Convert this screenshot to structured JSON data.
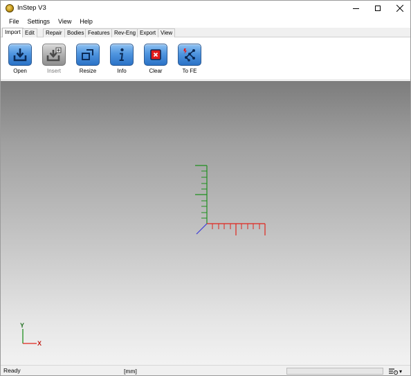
{
  "window": {
    "title": "InStep V3"
  },
  "menu": {
    "items": [
      "File",
      "Settings",
      "View",
      "Help"
    ]
  },
  "tabs": [
    {
      "label": "Import",
      "active": true
    },
    {
      "label": "Edit",
      "active": false
    },
    {
      "label": "Repair",
      "active": false
    },
    {
      "label": "Bodies",
      "active": false
    },
    {
      "label": "Features",
      "active": false
    },
    {
      "label": "Rev-Eng",
      "active": false
    },
    {
      "label": "Export",
      "active": false
    },
    {
      "label": "View",
      "active": false
    }
  ],
  "toolbar": {
    "tools": [
      {
        "label": "Open",
        "icon": "open-import-icon",
        "enabled": true
      },
      {
        "label": "Insert",
        "icon": "insert-icon",
        "enabled": false
      },
      {
        "label": "Resize",
        "icon": "resize-icon",
        "enabled": true
      },
      {
        "label": "Info",
        "icon": "info-icon",
        "enabled": true
      },
      {
        "label": "Clear",
        "icon": "clear-icon",
        "enabled": true
      },
      {
        "label": "To FE",
        "icon": "to-fe-icon",
        "enabled": true
      }
    ]
  },
  "viewport": {
    "triad": {
      "y_label": "Y",
      "x_label": "X"
    }
  },
  "status": {
    "text": "Ready",
    "units": "[mm]",
    "progress": 0
  },
  "colors": {
    "axis_x": "#e0241c",
    "axis_y": "#1f8f1f",
    "axis_z": "#3b3bd8",
    "accent": "#2b72c6"
  }
}
